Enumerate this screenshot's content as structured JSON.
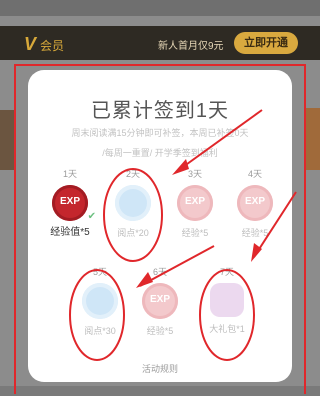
{
  "header_bar": {
    "logo": "V",
    "label": "会员",
    "promo": "新人首月仅9元",
    "cta": "立即开通"
  },
  "popup": {
    "title": "已累计签到1天",
    "subtitle_line1": "周末阅读满15分钟即可补签，本周已补签0天",
    "subtitle_line2": "/每周一重置/ 开学季签到福利",
    "days": [
      {
        "label": "1天",
        "reward": "经验值*5",
        "state": "done",
        "icon": "exp-coin"
      },
      {
        "label": "2天",
        "reward": "阅点*20",
        "state": "pending",
        "icon": "readpoint-coin"
      },
      {
        "label": "3天",
        "reward": "经验*5",
        "state": "pending",
        "icon": "exp-coin"
      },
      {
        "label": "4天",
        "reward": "经验*5",
        "state": "pending",
        "icon": "exp-coin"
      },
      {
        "label": "5天",
        "reward": "阅点*30",
        "state": "pending",
        "icon": "readpoint-coin"
      },
      {
        "label": "6天",
        "reward": "经验*5",
        "state": "pending",
        "icon": "exp-coin"
      },
      {
        "label": "7天",
        "reward": "大礼包*1",
        "state": "pending",
        "icon": "gift-icon"
      }
    ],
    "exp_badge_text": "EXP",
    "rules_link": "活动规则"
  },
  "colors": {
    "annotation_red": "#e0272b",
    "exp_red": "#c4262d",
    "vip_gold": "#d9a93f"
  }
}
